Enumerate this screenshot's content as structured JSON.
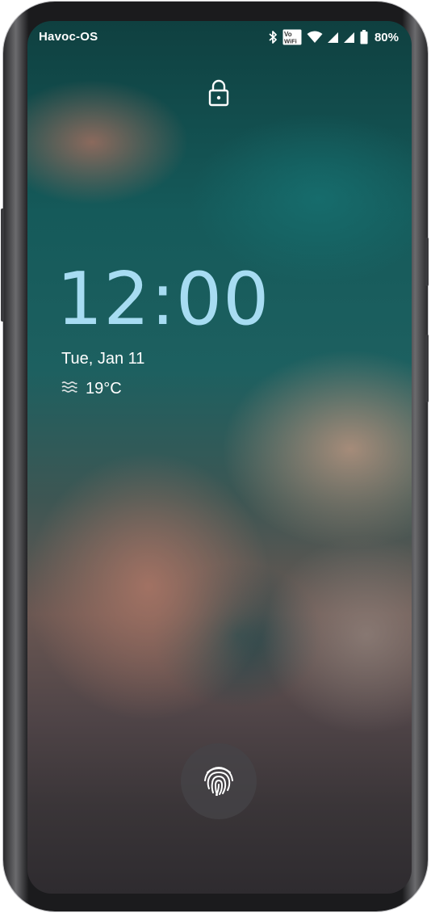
{
  "status_bar": {
    "carrier": "Havoc-OS",
    "icons": [
      "bluetooth-icon",
      "volte-icon",
      "vowifi-icon",
      "wifi-icon",
      "signal-icon",
      "signal-icon-2",
      "battery-icon"
    ],
    "volte_label": "Vo",
    "vowifi_label": "WiFi",
    "battery_percent": "80%"
  },
  "lockscreen": {
    "lock_icon": "lock-icon",
    "time": "12:00",
    "date": "Tue, Jan 11",
    "weather": {
      "icon": "haze-icon",
      "temperature": "19°C"
    },
    "fingerprint_icon": "fingerprint-icon"
  },
  "colors": {
    "clock": "#a7dcf2",
    "text": "#ffffff"
  }
}
